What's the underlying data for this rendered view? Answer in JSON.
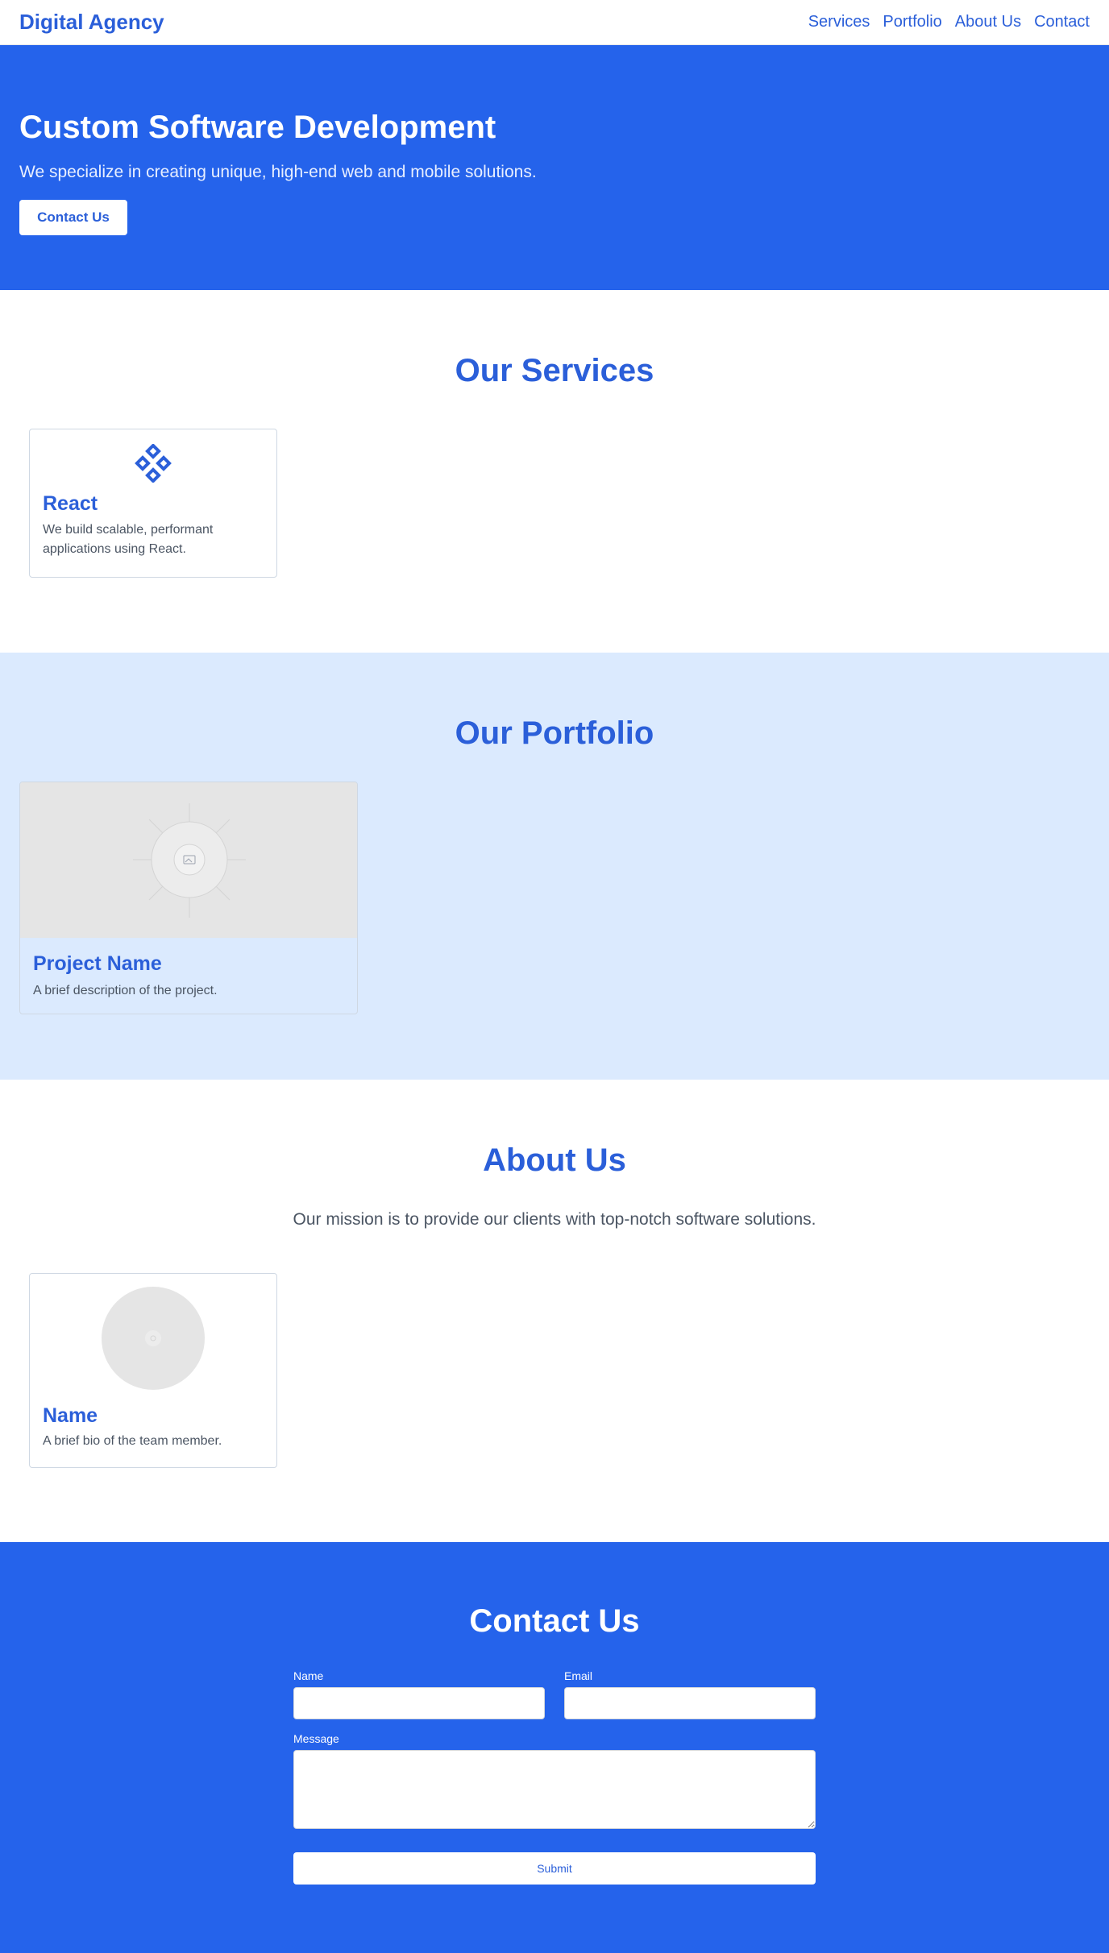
{
  "nav": {
    "brand": "Digital Agency",
    "links": [
      "Services",
      "Portfolio",
      "About Us",
      "Contact"
    ]
  },
  "hero": {
    "title": "Custom Software Development",
    "subtitle": "We specialize in creating unique, high-end web and mobile solutions.",
    "cta_label": "Contact Us"
  },
  "services": {
    "title": "Our Services",
    "items": [
      {
        "icon": "react-icon",
        "name": "React",
        "description": "We build scalable, performant applications using React."
      }
    ]
  },
  "portfolio": {
    "title": "Our Portfolio",
    "items": [
      {
        "image_icon": "image-placeholder-icon",
        "name": "Project Name",
        "description": "A brief description of the project."
      }
    ]
  },
  "about": {
    "title": "About Us",
    "mission": "Our mission is to provide our clients with top-notch software solutions.",
    "team": [
      {
        "avatar_icon": "avatar-placeholder-icon",
        "name": "Name",
        "bio": "A brief bio of the team member."
      }
    ]
  },
  "contact": {
    "title": "Contact Us",
    "name_label": "Name",
    "email_label": "Email",
    "message_label": "Message",
    "submit_label": "Submit"
  },
  "colors": {
    "primary": "#2563eb",
    "accent_text": "#2b5fd9",
    "portfolio_bg": "#dbeafe"
  }
}
